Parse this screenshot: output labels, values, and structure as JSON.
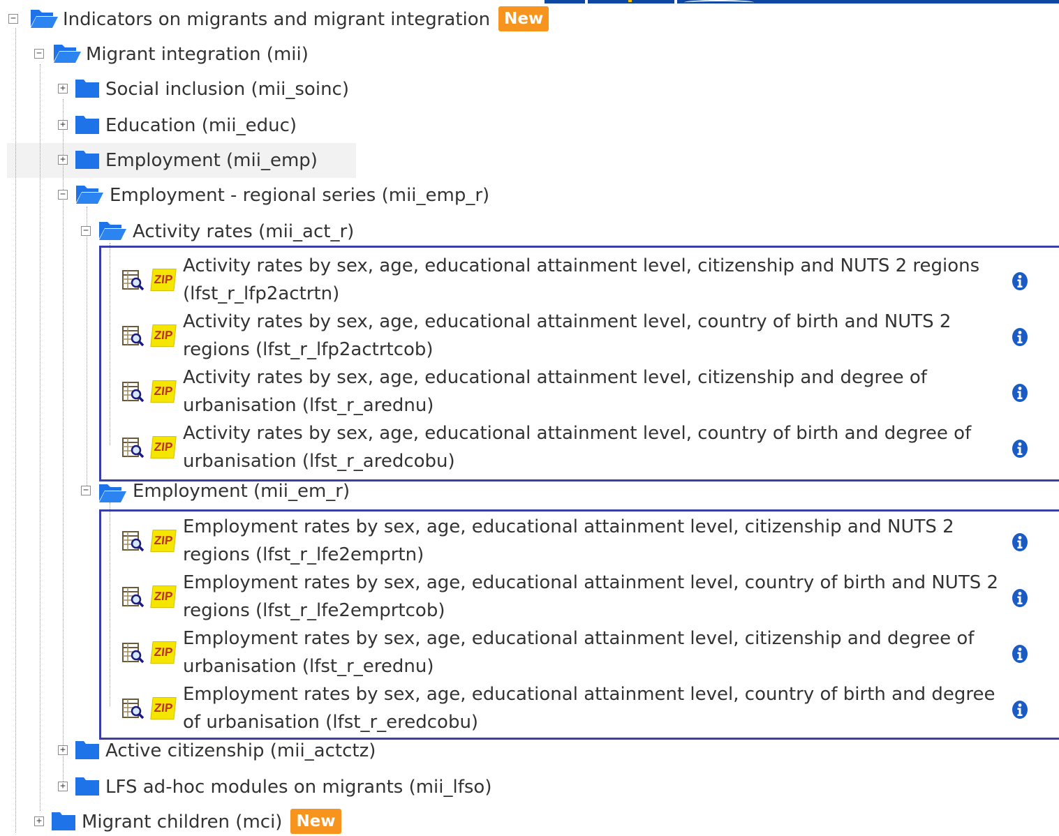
{
  "badge_new": "New",
  "icons": {
    "toggle_collapse": "minus-box-icon",
    "toggle_expand": "plus-box-icon",
    "folder_open": "open-folder-icon",
    "folder_closed": "closed-folder-icon",
    "dataset": "table-search-icon",
    "zip": "zip-icon",
    "info": "info-icon"
  },
  "colors": {
    "folder": "#1e73e8",
    "badge": "#f6941d",
    "highlight_box": "#3a3ea8",
    "info": "#1a5bc4",
    "zip": "#f5e600"
  },
  "zip_label": "ZIP",
  "tree": {
    "root": {
      "label": "Indicators on migrants and migrant integration"
    },
    "mii": {
      "label": "Migrant integration (mii)"
    },
    "soinc": {
      "label": "Social inclusion (mii_soinc)"
    },
    "educ": {
      "label": "Education (mii_educ)"
    },
    "emp": {
      "label": "Employment (mii_emp)"
    },
    "emp_r": {
      "label": "Employment - regional series (mii_emp_r)"
    },
    "act_r": {
      "label": "Activity rates (mii_act_r)",
      "datasets": [
        "Activity rates by sex, age, educational attainment level, citizenship and NUTS 2 regions (lfst_r_lfp2actrtn)",
        "Activity rates by sex, age, educational attainment level, country of birth and NUTS 2 regions (lfst_r_lfp2actrtcob)",
        "Activity rates by sex, age, educational attainment level, citizenship and degree of urbanisation (lfst_r_arednu)",
        "Activity rates by sex, age, educational attainment level, country of birth and degree of urbanisation (lfst_r_aredcobu)"
      ]
    },
    "em_r": {
      "label": "Employment (mii_em_r)",
      "datasets": [
        "Employment rates by sex, age, educational attainment level, citizenship and NUTS 2 regions (lfst_r_lfe2emprtn)",
        "Employment rates by sex, age, educational attainment level, country of birth and NUTS 2 regions (lfst_r_lfe2emprtcob)",
        "Employment rates by sex, age, educational attainment level, citizenship and degree of urbanisation (lfst_r_erednu)",
        "Employment rates by sex, age, educational attainment level, country of birth and degree of urbanisation (lfst_r_eredcobu)"
      ]
    },
    "actctz": {
      "label": "Active citizenship (mii_actctz)"
    },
    "lfso": {
      "label": "LFS ad-hoc modules on migrants (mii_lfso)"
    },
    "mci": {
      "label": "Migrant children (mci)"
    }
  }
}
